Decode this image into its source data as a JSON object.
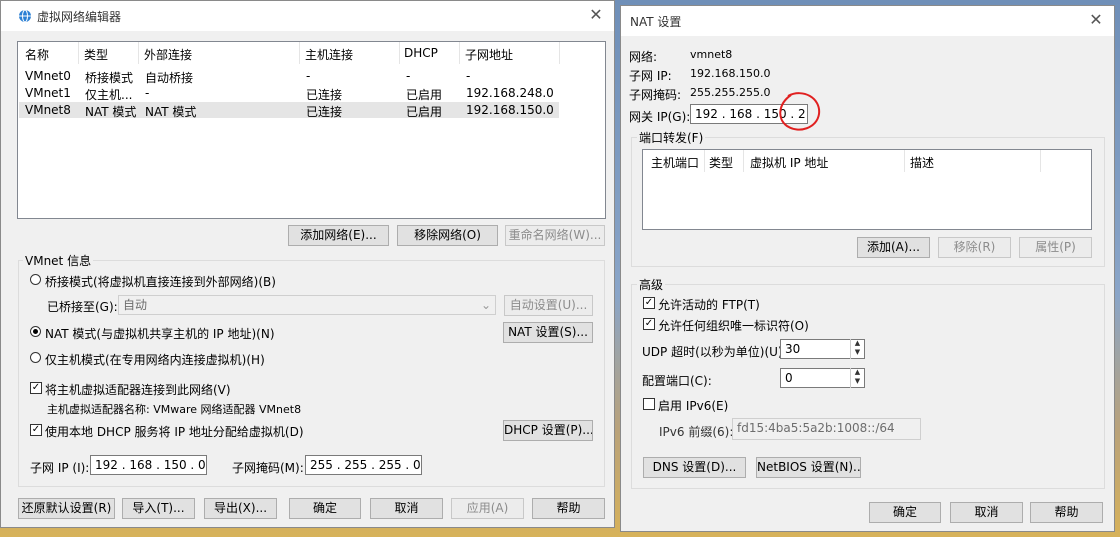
{
  "left": {
    "title": "虚拟网络编辑器",
    "columns": [
      "名称",
      "类型",
      "外部连接",
      "主机连接",
      "DHCP",
      "子网地址"
    ],
    "rows": [
      [
        "VMnet0",
        "桥接模式",
        "自动桥接",
        "-",
        "-",
        "-"
      ],
      [
        "VMnet1",
        "仅主机...",
        "-",
        "已连接",
        "已启用",
        "192.168.248.0"
      ],
      [
        "VMnet8",
        "NAT 模式",
        "NAT 模式",
        "已连接",
        "已启用",
        "192.168.150.0"
      ]
    ],
    "add_network": "添加网络(E)...",
    "remove_network": "移除网络(O)",
    "rename_network": "重命名网络(W)...",
    "vmnet_info": "VMnet 信息",
    "bridge_mode": "桥接模式(将虚拟机直接连接到外部网络)(B)",
    "bridged_to": "已桥接至(G):",
    "bridged_value": "自动",
    "auto_settings": "自动设置(U)...",
    "nat_mode": "NAT 模式(与虚拟机共享主机的 IP 地址)(N)",
    "nat_settings": "NAT 设置(S)...",
    "host_only": "仅主机模式(在专用网络内连接虚拟机)(H)",
    "connect_adapter": "将主机虚拟适配器连接到此网络(V)",
    "adapter_name": "主机虚拟适配器名称: VMware 网络适配器 VMnet8",
    "use_dhcp": "使用本地 DHCP 服务将 IP 地址分配给虚拟机(D)",
    "dhcp_settings": "DHCP 设置(P)...",
    "subnet_ip_label": "子网 IP (I):",
    "subnet_ip": "192 . 168 . 150 .  0",
    "subnet_mask_label": "子网掩码(M):",
    "subnet_mask": "255 . 255 . 255 .  0",
    "restore": "还原默认设置(R)",
    "import": "导入(T)...",
    "export": "导出(X)...",
    "ok": "确定",
    "cancel": "取消",
    "apply": "应用(A)",
    "help": "帮助"
  },
  "right": {
    "title": "NAT 设置",
    "network_label": "网络:",
    "network_value": "vmnet8",
    "subnet_ip_label": "子网 IP:",
    "subnet_ip_value": "192.168.150.0",
    "subnet_mask_label": "子网掩码:",
    "subnet_mask_value": "255.255.255.0",
    "gateway_label": "网关 IP(G):",
    "gateway_value": "192 . 168 . 150 .  2",
    "port_forwarding": "端口转发(F)",
    "pf_columns": [
      "主机端口",
      "类型",
      "虚拟机 IP 地址",
      "描述"
    ],
    "add": "添加(A)...",
    "remove": "移除(R)",
    "properties": "属性(P)",
    "advanced": "高级",
    "allow_ftp": "允许活动的 FTP(T)",
    "allow_oui": "允许任何组织唯一标识符(O)",
    "udp_timeout_label": "UDP 超时(以秒为单位)(U):",
    "udp_timeout_value": "30",
    "config_port_label": "配置端口(C):",
    "config_port_value": "0",
    "enable_ipv6": "启用 IPv6(E)",
    "ipv6_prefix_label": "IPv6 前缀(6):",
    "ipv6_prefix_value": "fd15:4ba5:5a2b:1008::/64",
    "dns_settings": "DNS 设置(D)...",
    "netbios_settings": "NetBIOS 设置(N)...",
    "ok": "确定",
    "cancel": "取消",
    "help": "帮助"
  },
  "accent_annotation_color": "#e02020"
}
